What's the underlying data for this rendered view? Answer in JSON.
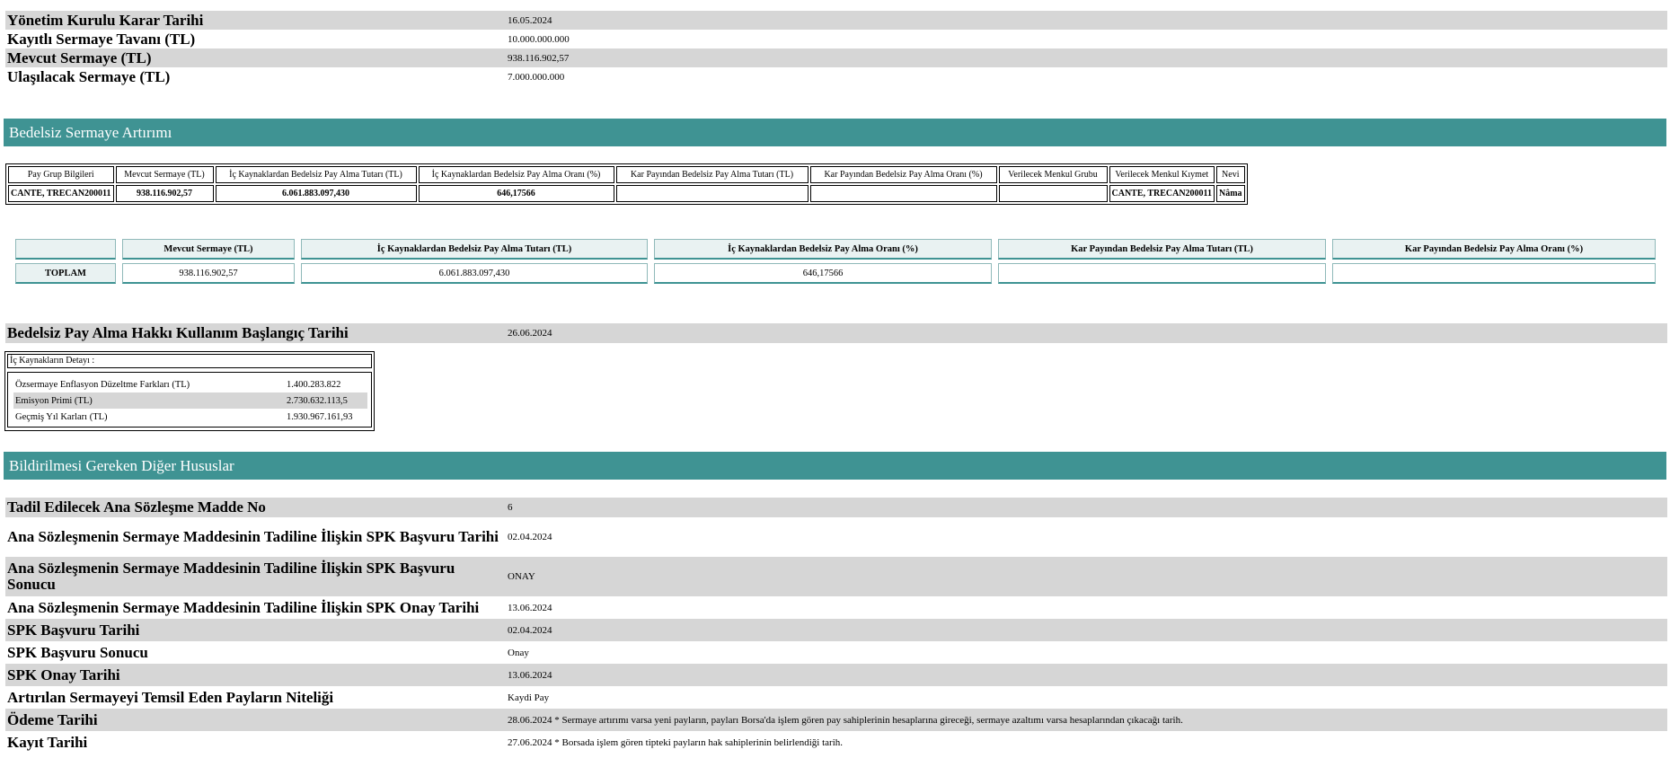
{
  "top_info": [
    {
      "label": "Yönetim Kurulu Karar Tarihi",
      "value": "16.05.2024"
    },
    {
      "label": "Kayıtlı Sermaye Tavanı (TL)",
      "value": "10.000.000.000"
    },
    {
      "label": "Mevcut Sermaye (TL)",
      "value": "938.116.902,57"
    },
    {
      "label": "Ulaşılacak Sermaye (TL)",
      "value": "7.000.000.000"
    }
  ],
  "section1_title": "Bedelsiz Sermaye Artırımı",
  "group_table": {
    "headers": [
      "Pay Grup Bilgileri",
      "Mevcut Sermaye (TL)",
      "İç Kaynaklardan Bedelsiz Pay Alma Tutarı (TL)",
      "İç Kaynaklardan Bedelsiz Pay Alma Oranı (%)",
      "Kar Payından Bedelsiz Pay Alma Tutarı (TL)",
      "Kar Payından Bedelsiz Pay Alma Oranı (%)",
      "Verilecek Menkul Grubu",
      "Verilecek Menkul Kıymet",
      "Nevi"
    ],
    "row": [
      "CANTE, TRECAN200011",
      "938.116.902,57",
      "6.061.883.097,430",
      "646,17566",
      "",
      "",
      "",
      "CANTE, TRECAN200011",
      "Nâma"
    ]
  },
  "totals_table": {
    "headers": [
      "",
      "Mevcut Sermaye (TL)",
      "İç Kaynaklardan Bedelsiz Pay Alma Tutarı (TL)",
      "İç Kaynaklardan Bedelsiz Pay Alma Oranı (%)",
      "Kar Payından Bedelsiz Pay Alma Tutarı (TL)",
      "Kar Payından Bedelsiz Pay Alma Oranı (%)"
    ],
    "row": [
      "TOPLAM",
      "938.116.902,57",
      "6.061.883.097,430",
      "646,17566",
      "",
      ""
    ]
  },
  "start_date": {
    "label": "Bedelsiz Pay Alma Hakkı Kullanım Başlangıç Tarihi",
    "value": "26.06.2024"
  },
  "ic_kaynaklar": {
    "title": "İç Kaynakların Detayı :",
    "items": [
      {
        "label": "Özsermaye Enflasyon Düzeltme Farkları (TL)",
        "value": "1.400.283.822"
      },
      {
        "label": "Emisyon Primi (TL)",
        "value": "2.730.632.113,5"
      },
      {
        "label": "Geçmiş Yıl Karları (TL)",
        "value": "1.930.967.161,93"
      }
    ]
  },
  "section2_title": "Bildirilmesi Gereken Diğer Hususlar",
  "other_info": [
    {
      "label": "Tadil Edilecek Ana Sözleşme Madde No",
      "value": "6"
    },
    {
      "label": "Ana Sözleşmenin Sermaye Maddesinin Tadiline İlişkin SPK Başvuru Tarihi",
      "value": "02.04.2024"
    },
    {
      "label": "Ana Sözleşmenin Sermaye Maddesinin Tadiline İlişkin SPK Başvuru Sonucu",
      "value": "ONAY"
    },
    {
      "label": "Ana Sözleşmenin Sermaye Maddesinin Tadiline İlişkin SPK Onay Tarihi",
      "value": "13.06.2024"
    },
    {
      "label": "SPK Başvuru Tarihi",
      "value": "02.04.2024"
    },
    {
      "label": "SPK Başvuru Sonucu",
      "value": "Onay"
    },
    {
      "label": "SPK Onay Tarihi",
      "value": "13.06.2024"
    },
    {
      "label": "Artırılan Sermayeyi Temsil Eden Payların Niteliği",
      "value": "Kaydi Pay"
    },
    {
      "label": "Ödeme Tarihi",
      "value": "28.06.2024 * Sermaye artırımı varsa yeni payların, payları Borsa'da işlem gören pay sahiplerinin hesaplarına gireceği, sermaye azaltımı varsa hesaplarından çıkacağı tarih."
    },
    {
      "label": "Kayıt Tarihi",
      "value": "27.06.2024 * Borsada işlem gören tipteki payların hak sahiplerinin belirlendiği tarih."
    }
  ]
}
